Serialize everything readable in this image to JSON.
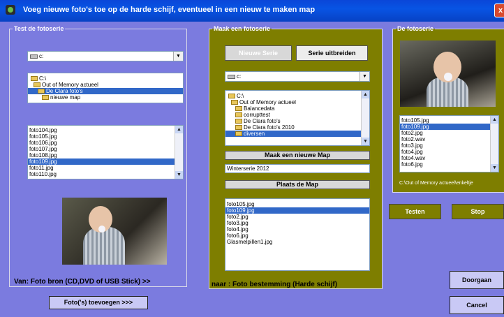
{
  "window": {
    "title": "Voeg nieuwe foto's toe op de harde schijf, eventueel in een nieuw te maken map",
    "close_label": "x"
  },
  "panel_test": {
    "legend": "Test de fotoserie",
    "drive": "c:",
    "folders": [
      "C:\\",
      "Out of Memory actueel",
      "De Clara foto's",
      "nieuwe map"
    ],
    "files": [
      "foto104.jpg",
      "foto105.jpg",
      "foto106.jpg",
      "foto107.jpg",
      "foto108.jpg",
      "foto109.jpg",
      "foto11.jpg",
      "foto110.jpg"
    ],
    "source_label": "Van: Foto bron (CD,DVD of USB Stick)  >>",
    "add_button": "Foto('s) toevoegen  >>>"
  },
  "panel_make": {
    "legend": "Maak een fotoserie",
    "new_series_button": "Nieuwe Serie",
    "extend_series_button": "Serie uitbreiden",
    "drive": "c:",
    "folders": [
      "C:\\",
      "Out of Memory actueel",
      "Balancedata",
      "corrupttest",
      "De Clara foto's",
      "De Clara foto's 2010",
      "diversen"
    ],
    "new_folder_button": "Maak een nieuwe Map",
    "new_folder_value": "Winterserie 2012",
    "place_folder_button": "Plaats de Map",
    "files": [
      "foto105.jpg",
      "foto109.jpg",
      "foto2.jpg",
      "foto3.jpg",
      "foto4.jpg",
      "foto6.jpg",
      "Glasmelpillen1.jpg"
    ],
    "dest_label": "naar :  Foto bestemming (Harde schijf)"
  },
  "panel_series": {
    "legend": "De fotoserie",
    "files": [
      "foto105.jpg",
      "foto109.jpg",
      "foto2.jpg",
      "foto2.wav",
      "foto3.jpg",
      "foto4.jpg",
      "foto4.wav",
      "foto6.jpg"
    ],
    "path": "C:\\Out of Memory actueel\\enkeltje"
  },
  "buttons": {
    "test": "Testen",
    "stop": "Stop",
    "continue": "Doorgaan",
    "cancel": "Cancel"
  }
}
